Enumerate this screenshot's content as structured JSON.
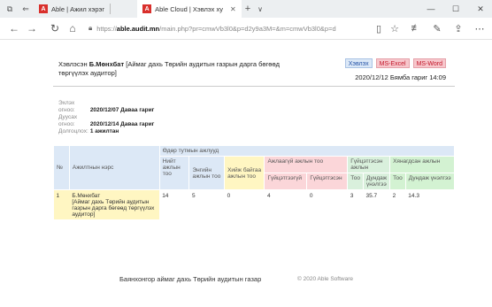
{
  "browser": {
    "tabs": [
      {
        "label": "Able | Ажил хэрэг",
        "favicon": "A"
      },
      {
        "label": "Able Cloud | Хэвлэх ху",
        "favicon": "A"
      }
    ],
    "new_tab": "+",
    "tab_menu": "∨",
    "url_prefix": "https://",
    "url_host": "able.audit.mn",
    "url_path": "/main.php?pr=cmwVb3l0&p=d2y9a3M=&m=cmwVb3l0&p=d"
  },
  "report": {
    "title_prefix": "Хэвлэсэн",
    "title_name": "Б.Мөнхбат",
    "title_suffix": "[Аймаг дахь Төрийн аудитын газрын дарга бөгөөд төргүүлэх аудитор]",
    "buttons": {
      "print": "Хэвлэх",
      "excel": "MS-Excel",
      "word": "MS-Word"
    },
    "printed_at": "2020/12/12 Бямба гариг 14:09",
    "info": [
      {
        "key": "Эхлэх огноо:",
        "value": "2020/12/07 Даваа гариг"
      },
      {
        "key": "Дуусах огноо:",
        "value": "2020/12/14 Даваа гариг"
      },
      {
        "key": "Долгоцлох:",
        "value": "1 ажилтан"
      }
    ],
    "table": {
      "group_header": "Өдөр тутмын ажлууд",
      "col_no": "№",
      "col_employee": "Ажилтнын нэрс",
      "col_total": "Нийт ажлын тоо",
      "col_normal": "Энгийн ажлын тоо",
      "col_overdue": "Хийж байгаа ажлын тоо",
      "col_urgent": "Ажлаагүй ажлын тоо",
      "col_urgent_sub1": "Гүйцэтгээгүй",
      "col_urgent_sub2": "Гүйцэтгэсэн",
      "col_done": "Гүйцэтгэсэн ажлын",
      "col_done_sub1": "Тоо",
      "col_done_sub2": "Дундаж үнэлгээ",
      "col_checked": "Хянагдсан ажлын",
      "col_checked_sub1": "Тоо",
      "col_checked_sub2": "Дундаж үнэлгээ",
      "rows": [
        {
          "no": "1",
          "name": "Б.Мөнхбат",
          "position": "[Аймаг дахь Төрийн аудитын газрын дарга бөгөөд төргүүлэх аудитор]",
          "total": "14",
          "normal": "5",
          "overdue": "0",
          "not_done": "4",
          "done_u": "0",
          "done_cnt": "3",
          "done_avg": "35.7",
          "checked_cnt": "2",
          "checked_avg": "14.3"
        }
      ]
    },
    "footer_org": "Баянхонгор аймаг дахь Төрийн аудитын газар",
    "footer_copy": "© 2020 Able Software"
  },
  "colors": {
    "accent_red": "#d9302c",
    "header_blue": "#dce8f6",
    "yellow": "#fff6c2",
    "pink": "#fbd6d9",
    "green": "#d9f0dc"
  },
  "icons": [
    "tab-actions-icon",
    "tab-back-icon",
    "back-arrow-icon",
    "forward-arrow-icon",
    "refresh-icon",
    "home-icon",
    "lock-icon",
    "reading-view-icon",
    "favorite-star-icon",
    "favorites-icon",
    "pen-icon",
    "share-icon",
    "more-icon"
  ]
}
